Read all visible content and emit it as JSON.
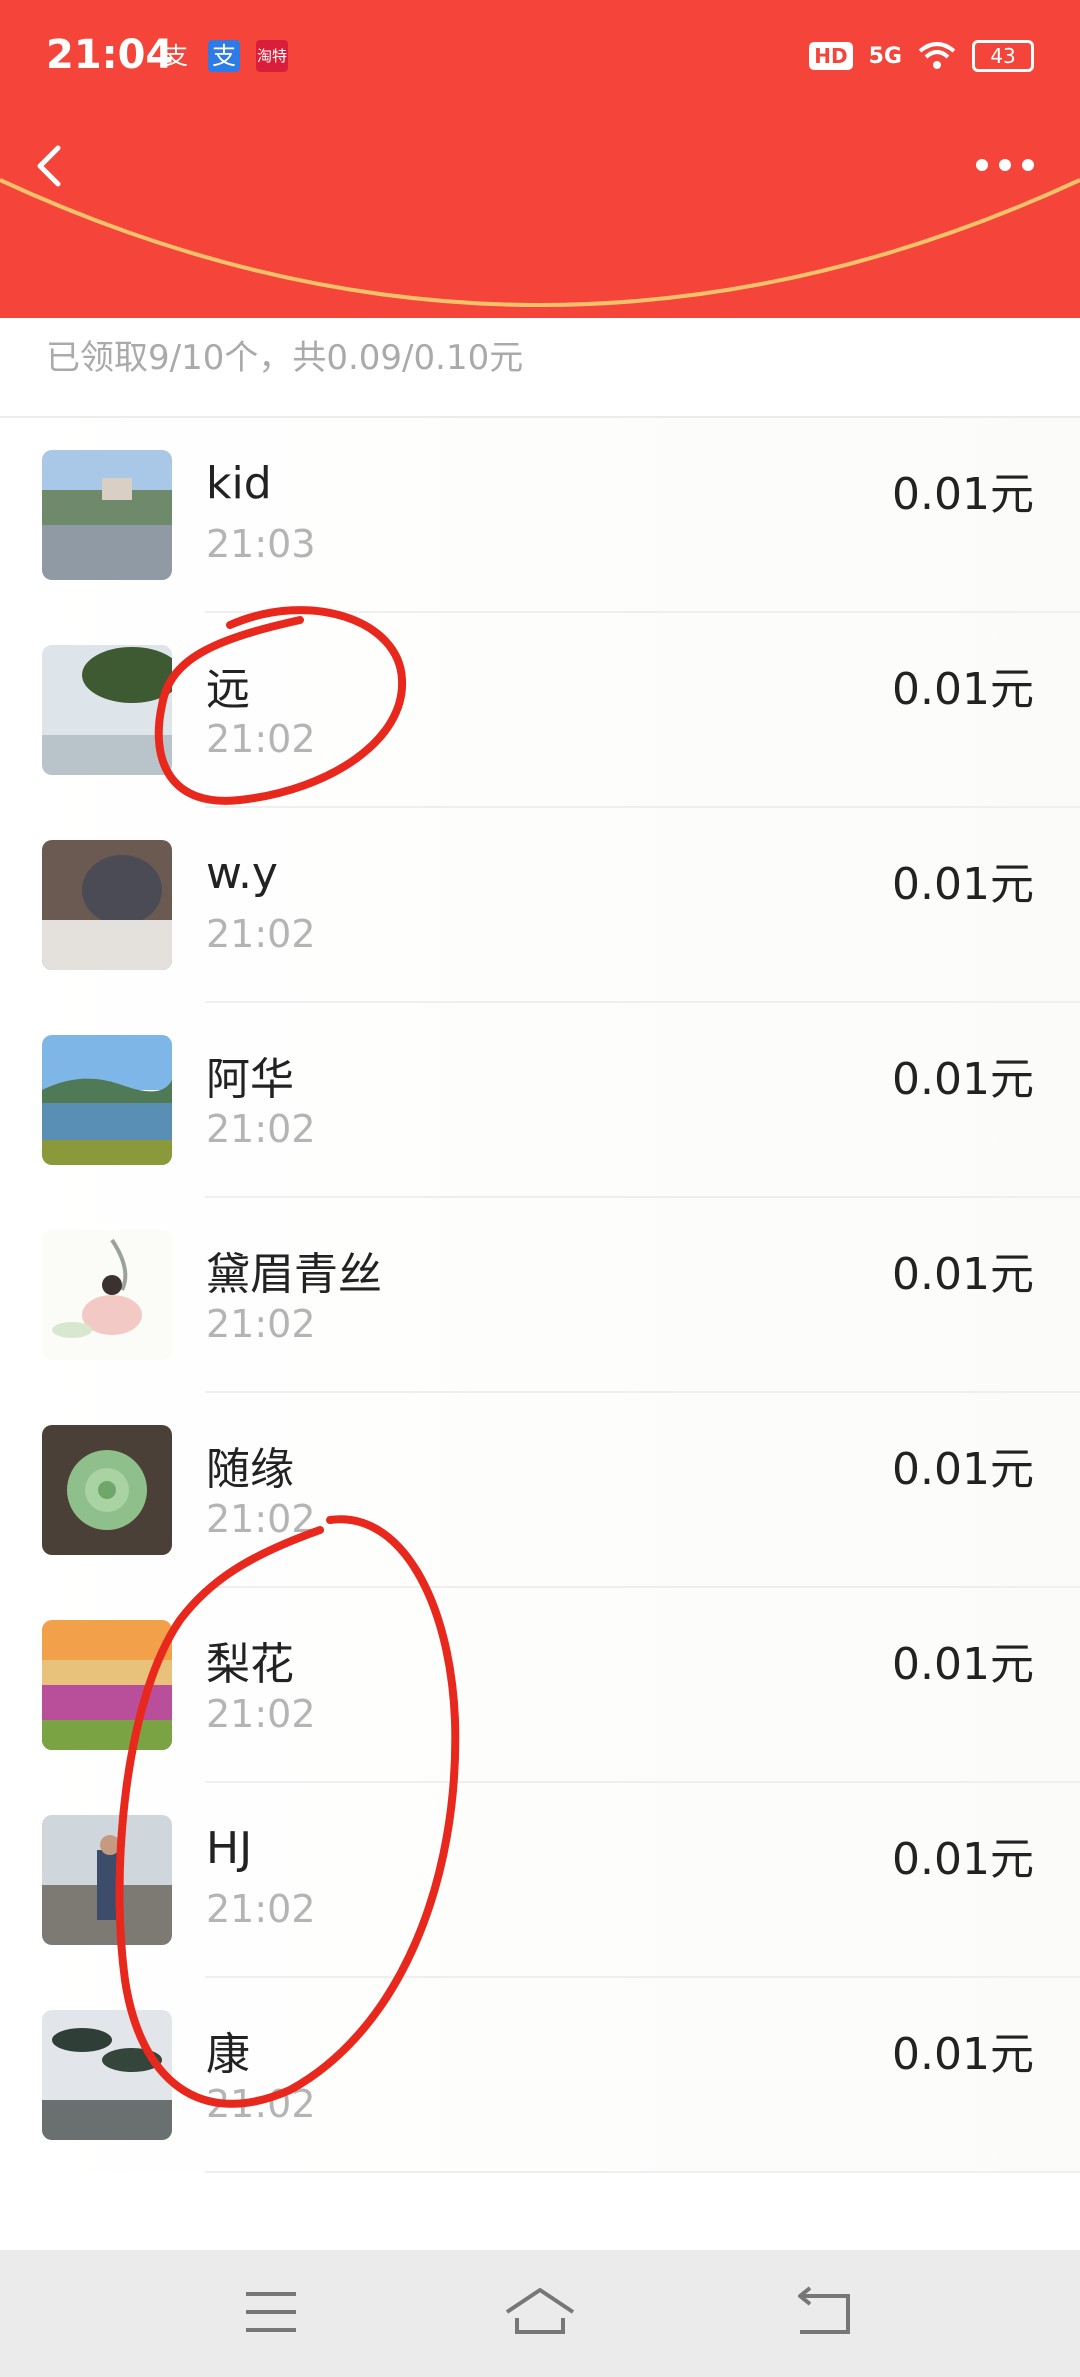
{
  "status_bar": {
    "time": "21:04",
    "notification_icons": [
      "支",
      "支",
      "淘特"
    ],
    "hd_badge": "HD",
    "network": "5G",
    "battery": "43"
  },
  "nav": {
    "back_icon": "chevron-left-icon",
    "more_icon": "more-dots-icon"
  },
  "summary_text": "已领取9/10个，共0.09/0.10元",
  "recipients": [
    {
      "name": "kid",
      "time": "21:03",
      "amount": "0.01元"
    },
    {
      "name": "远",
      "time": "21:02",
      "amount": "0.01元"
    },
    {
      "name": "w.y",
      "time": "21:02",
      "amount": "0.01元"
    },
    {
      "name": "阿华",
      "time": "21:02",
      "amount": "0.01元"
    },
    {
      "name": "黛眉青丝",
      "time": "21:02",
      "amount": "0.01元"
    },
    {
      "name": "随缘",
      "time": "21:02",
      "amount": "0.01元"
    },
    {
      "name": "梨花",
      "time": "21:02",
      "amount": "0.01元"
    },
    {
      "name": "HJ",
      "time": "21:02",
      "amount": "0.01元"
    },
    {
      "name": "康",
      "time": "21:02",
      "amount": "0.01元"
    }
  ],
  "colors": {
    "header_red": "#f5443a",
    "header_edge": "#f5c26b",
    "annotation_red": "#e8281c"
  },
  "system_nav": {
    "menu_icon": "menu-icon",
    "home_icon": "home-icon",
    "back_icon": "back-icon"
  }
}
